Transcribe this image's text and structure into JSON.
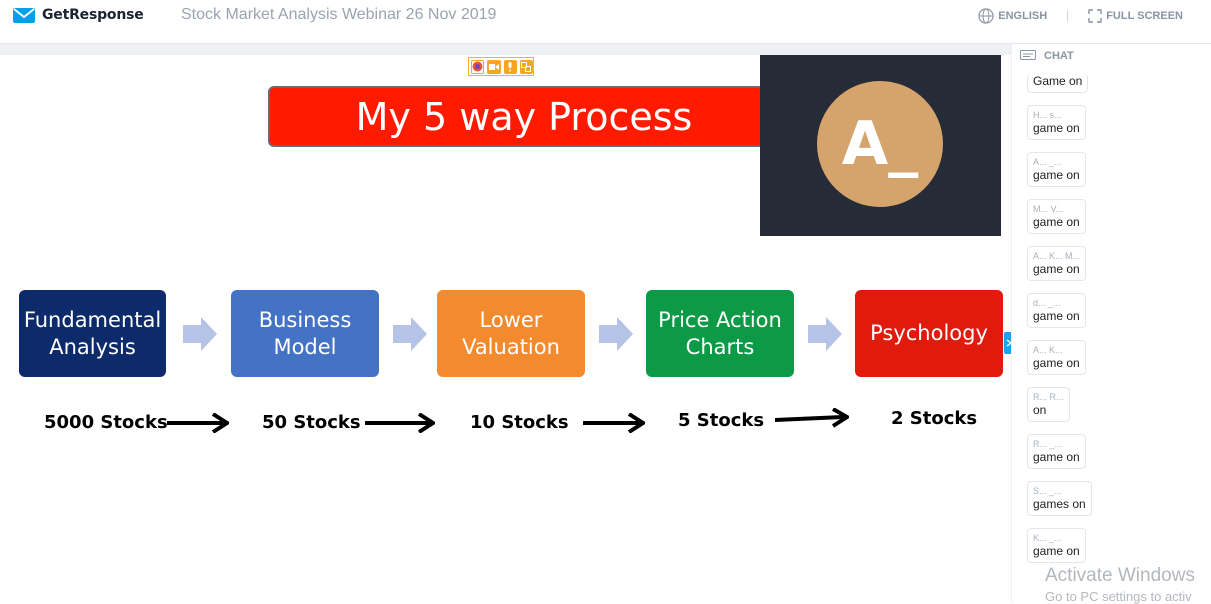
{
  "header": {
    "logo_text": "GetResponse",
    "webinar_title": "Stock Market Analysis Webinar 26 Nov 2019",
    "language_label": "ENGLISH",
    "fullscreen_label": "FULL SCREEN"
  },
  "slide": {
    "title": "My 5 way Process",
    "steps": [
      {
        "label_line1": "Fundamental",
        "label_line2": "Analysis",
        "color": "#0d2a6b"
      },
      {
        "label_line1": "Business",
        "label_line2": "Model",
        "color": "#4472c4"
      },
      {
        "label_line1": "Lower",
        "label_line2": "Valuation",
        "color": "#f48a2e"
      },
      {
        "label_line1": "Price Action",
        "label_line2": "Charts",
        "color": "#0d9a46"
      },
      {
        "label_line1": "Psychology",
        "label_line2": "",
        "color": "#e01a0c"
      }
    ],
    "counts": [
      "5000 Stocks",
      "50 Stocks",
      "10 Stocks",
      "5 Stocks",
      "2 Stocks"
    ]
  },
  "video": {
    "avatar_initials": "A_",
    "avatar_color": "#d4a46c"
  },
  "chat": {
    "header": "CHAT",
    "messages": [
      {
        "who": "",
        "text": "Game on"
      },
      {
        "who": "H... s...",
        "text": "game on"
      },
      {
        "who": "A... _...",
        "text": "game on"
      },
      {
        "who": "M... V...",
        "text": "game on"
      },
      {
        "who": "A... K... M...",
        "text": "game on"
      },
      {
        "who": "d... _...",
        "text": "game on"
      },
      {
        "who": "A... K...",
        "text": "game on"
      },
      {
        "who": "R... R...",
        "text": "on"
      },
      {
        "who": "R... _...",
        "text": "game on"
      },
      {
        "who": "S... _...",
        "text": "games on"
      },
      {
        "who": "K... _...",
        "text": "game on"
      }
    ]
  },
  "os": {
    "watermark_line1": "Activate Windows",
    "watermark_line2": "Go to PC settings to activ"
  }
}
